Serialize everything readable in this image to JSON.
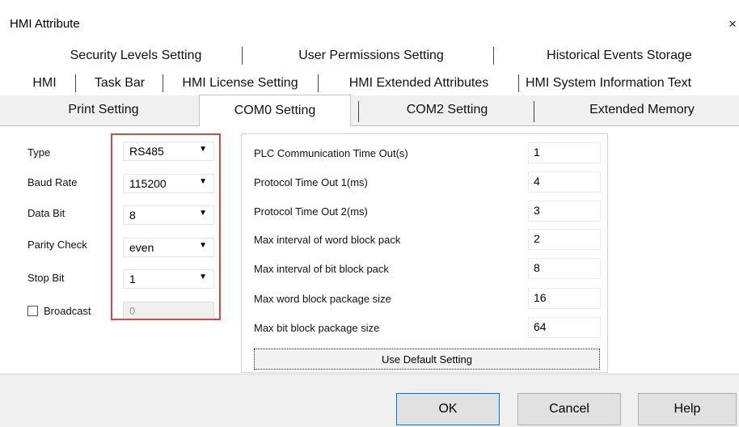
{
  "window": {
    "title": "HMI Attribute",
    "close_glyph": "×"
  },
  "tabs": {
    "row1": [
      "Security Levels Setting",
      "User Permissions Setting",
      "Historical Events Storage"
    ],
    "row2": [
      "HMI",
      "Task Bar",
      "HMI License Setting",
      "HMI Extended Attributes",
      "HMI System Information Text"
    ],
    "row3": [
      "Print Setting",
      "COM0 Setting",
      "COM2 Setting",
      "Extended Memory"
    ],
    "active": "COM0 Setting"
  },
  "serial": {
    "type_label": "Type",
    "type_value": "RS485",
    "baud_label": "Baud Rate",
    "baud_value": "115200",
    "databit_label": "Data Bit",
    "databit_value": "8",
    "parity_label": "Parity Check",
    "parity_value": "even",
    "stopbit_label": "Stop Bit",
    "stopbit_value": "1",
    "broadcast_label": "Broadcast",
    "broadcast_checked": false,
    "broadcast_value": "0",
    "arrow_glyph": "▼"
  },
  "params": [
    {
      "label": "PLC Communication Time Out(s)",
      "value": "1"
    },
    {
      "label": "Protocol Time Out 1(ms)",
      "value": "4"
    },
    {
      "label": "Protocol Time Out 2(ms)",
      "value": "3"
    },
    {
      "label": "Max interval of word block pack",
      "value": "2"
    },
    {
      "label": "Max interval of bit block pack",
      "value": "8"
    },
    {
      "label": "Max word block package size",
      "value": "16"
    },
    {
      "label": "Max bit block package size",
      "value": "64"
    }
  ],
  "default_button": "Use Default Setting",
  "buttons": {
    "ok": "OK",
    "cancel": "Cancel",
    "help": "Help"
  },
  "colors": {
    "highlight": "#e04646",
    "dialog_bg": "#f0f0f0",
    "focus": "#0078d7"
  }
}
